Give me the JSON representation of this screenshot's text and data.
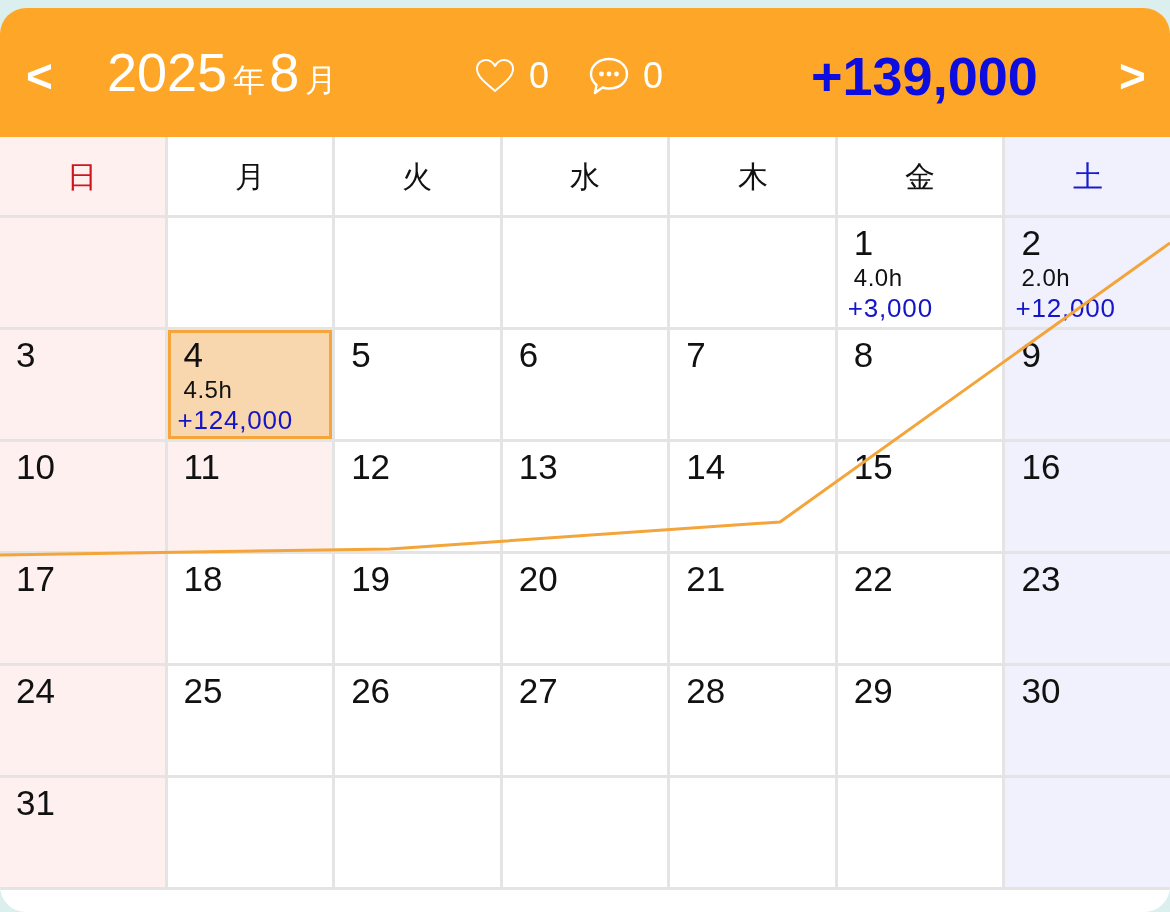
{
  "header": {
    "prev_button": "<",
    "title": {
      "year": "2025",
      "year_unit": "年",
      "month": "8",
      "month_unit": "月"
    },
    "likes": "0",
    "comments": "0",
    "total": "+139,000",
    "next_button": ">"
  },
  "weekdays": [
    {
      "label": "日",
      "kind": "sunday"
    },
    {
      "label": "月",
      "kind": "weekday"
    },
    {
      "label": "火",
      "kind": "weekday"
    },
    {
      "label": "水",
      "kind": "weekday"
    },
    {
      "label": "木",
      "kind": "weekday"
    },
    {
      "label": "金",
      "kind": "weekday"
    },
    {
      "label": "土",
      "kind": "saturday"
    }
  ],
  "weeks": [
    [
      {
        "kind": "empty"
      },
      {
        "kind": "empty"
      },
      {
        "kind": "empty"
      },
      {
        "kind": "empty"
      },
      {
        "kind": "empty"
      },
      {
        "kind": "day",
        "day": "1",
        "hours": "4.0h",
        "amount": "+3,000",
        "selected": false,
        "holiday": false
      },
      {
        "kind": "day",
        "day": "2",
        "hours": "2.0h",
        "amount": "+12,000",
        "selected": false,
        "holiday": false
      }
    ],
    [
      {
        "kind": "day",
        "day": "3",
        "selected": false
      },
      {
        "kind": "day",
        "day": "4",
        "hours": "4.5h",
        "amount": "+124,000",
        "selected": true
      },
      {
        "kind": "day",
        "day": "5",
        "selected": false,
        "holiday": false
      },
      {
        "kind": "day",
        "day": "6",
        "selected": false,
        "holiday": false
      },
      {
        "kind": "day",
        "day": "7",
        "selected": false,
        "holiday": false
      },
      {
        "kind": "day",
        "day": "8",
        "selected": false,
        "holiday": false
      },
      {
        "kind": "day",
        "day": "9",
        "selected": false,
        "holiday": false
      }
    ],
    [
      {
        "kind": "day",
        "day": "10",
        "selected": false
      },
      {
        "kind": "day",
        "day": "11",
        "selected": false,
        "holiday": true
      },
      {
        "kind": "day",
        "day": "12",
        "selected": false,
        "holiday": false
      },
      {
        "kind": "day",
        "day": "13",
        "selected": false,
        "holiday": false
      },
      {
        "kind": "day",
        "day": "14",
        "selected": false,
        "holiday": false
      },
      {
        "kind": "day",
        "day": "15",
        "selected": false,
        "holiday": false
      },
      {
        "kind": "day",
        "day": "16",
        "selected": false,
        "holiday": false
      }
    ],
    [
      {
        "kind": "day",
        "day": "17",
        "selected": false
      },
      {
        "kind": "day",
        "day": "18",
        "selected": false,
        "holiday": false
      },
      {
        "kind": "day",
        "day": "19",
        "selected": false,
        "holiday": false
      },
      {
        "kind": "day",
        "day": "20",
        "selected": false,
        "holiday": false
      },
      {
        "kind": "day",
        "day": "21",
        "selected": false,
        "holiday": false
      },
      {
        "kind": "day",
        "day": "22",
        "selected": false,
        "holiday": false
      },
      {
        "kind": "day",
        "day": "23",
        "selected": false,
        "holiday": false
      }
    ],
    [
      {
        "kind": "day",
        "day": "24",
        "selected": false
      },
      {
        "kind": "day",
        "day": "25",
        "selected": false,
        "holiday": false
      },
      {
        "kind": "day",
        "day": "26",
        "selected": false,
        "holiday": false
      },
      {
        "kind": "day",
        "day": "27",
        "selected": false,
        "holiday": false
      },
      {
        "kind": "day",
        "day": "28",
        "selected": false,
        "holiday": false
      },
      {
        "kind": "day",
        "day": "29",
        "selected": false,
        "holiday": false
      },
      {
        "kind": "day",
        "day": "30",
        "selected": false,
        "holiday": false
      }
    ],
    [
      {
        "kind": "day",
        "day": "31",
        "selected": false
      },
      {
        "kind": "empty"
      },
      {
        "kind": "empty"
      },
      {
        "kind": "empty"
      },
      {
        "kind": "empty"
      },
      {
        "kind": "empty"
      },
      {
        "kind": "empty"
      }
    ]
  ]
}
